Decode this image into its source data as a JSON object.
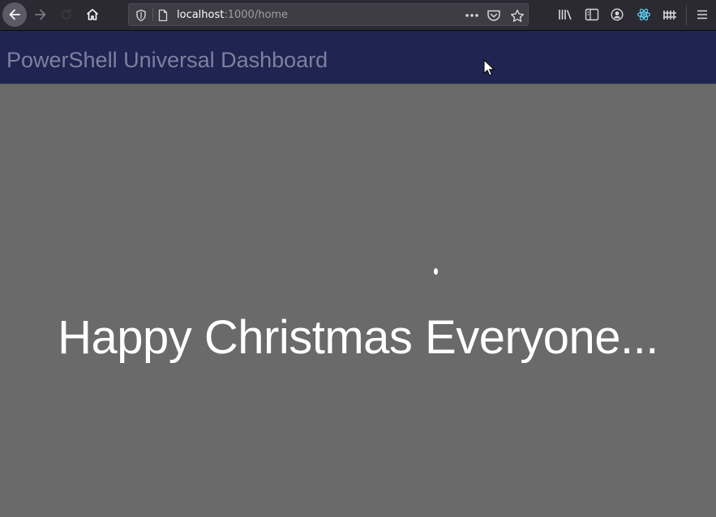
{
  "browser": {
    "url_host": "localhost",
    "url_rest": ":1000/home",
    "nav_icons": [
      "back-icon",
      "forward-icon",
      "reload-icon",
      "home-icon"
    ],
    "urlbar_icons": [
      "shield-icon",
      "page-icon",
      "more-icon",
      "pocket-icon",
      "star-icon"
    ],
    "toolbar_icons": [
      "library-icon",
      "sidebar-icon",
      "account-icon",
      "react-devtools-icon",
      "extension-icon",
      "menu-icon"
    ]
  },
  "dashboard": {
    "title": "PowerShell Universal Dashboard",
    "greeting": "Happy Christmas Everyone..."
  },
  "colors": {
    "browser_toolbar": "#2b2a33",
    "appbar": "#1f2451",
    "title_text": "#7e809e",
    "content_background": "#6a6a6a",
    "greeting_text": "#ffffff"
  }
}
